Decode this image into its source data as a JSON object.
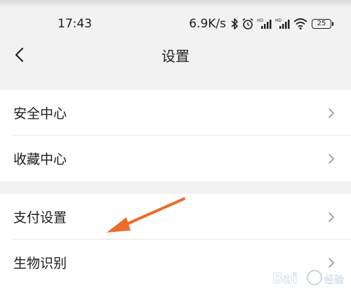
{
  "status": {
    "time": "17:43",
    "net_speed": "6.9K/s",
    "battery": "25",
    "icons": [
      "bluetooth-icon",
      "alarm-icon",
      "signal-hd-icon",
      "signal-hd-icon",
      "wifi-icon",
      "battery-icon"
    ]
  },
  "header": {
    "title": "设置",
    "back_icon": "chevron-left-icon"
  },
  "groups": [
    {
      "items": [
        {
          "label": "安全中心"
        },
        {
          "label": "收藏中心"
        }
      ]
    },
    {
      "items": [
        {
          "label": "支付设置"
        },
        {
          "label": "生物识别"
        }
      ]
    }
  ],
  "annotation": {
    "arrow_color": "#ec6d2a",
    "watermark": "Bai经验"
  }
}
